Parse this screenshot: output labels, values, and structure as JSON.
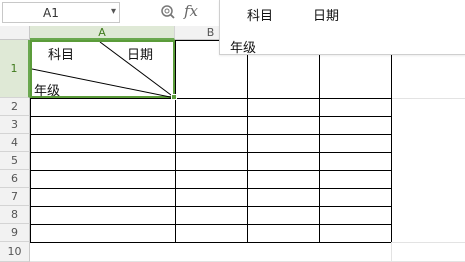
{
  "formula_bar": {
    "name_box": "A1",
    "fx_label": "fx",
    "content_line1_a": "科目",
    "content_line1_b": "日期",
    "content_line2": "年级"
  },
  "columns": [
    "A",
    "B"
  ],
  "rows": [
    "1",
    "2",
    "3",
    "4",
    "5",
    "6",
    "7",
    "8",
    "9",
    "10"
  ],
  "cell_a1": {
    "subject": "科目",
    "date": "日期",
    "grade": "年级"
  },
  "colors": {
    "selection": "#5b9c3a",
    "header_bg": "#f2f2f2"
  }
}
